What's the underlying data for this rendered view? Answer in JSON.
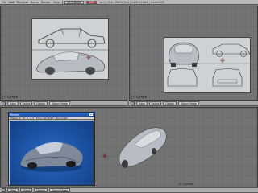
{
  "app": {
    "menu": [
      "File",
      "Add",
      "Timeline",
      "Game",
      "Render",
      "Help"
    ],
    "screen_field": "SR:2-Model",
    "scene_field": "SCE:",
    "stats": "Ve:1 | Fa:0 | Ed:0 | Fa:4 | Ob:1-1 | La:1 | Mem:4.5M"
  },
  "viewports": {
    "top_left_label": "(1) Camera",
    "top_right_label": "(1) Camera",
    "bottom_label": "(1) Camera"
  },
  "header": {
    "view": "View",
    "select": "Select",
    "object": "Object",
    "mode": "Object Mode"
  },
  "render_window": {
    "title": "Render",
    "info": "Image: 1 | Tri: 2 | 1.5 | Time: 00:00.62 | Mem:4.5M"
  },
  "colors": {
    "viewport_bg": "#737373",
    "car_body": "#b8bcc4",
    "render_bg": "#1b4f9e"
  }
}
